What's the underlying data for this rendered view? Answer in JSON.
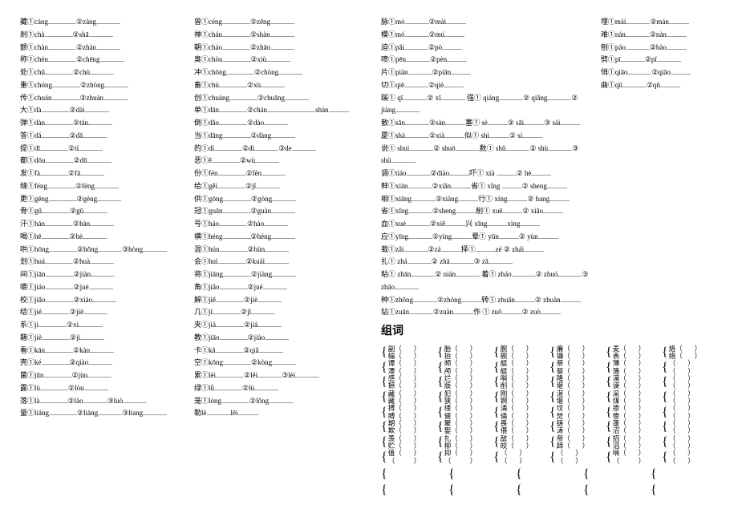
{
  "leftA": [
    {
      "c": "藏",
      "m1": "cáng",
      "m2": "zàng"
    },
    {
      "c": "刹",
      "m1": "chà",
      "m2": "shā"
    },
    {
      "c": "颤",
      "m1": "chàn",
      "m2": "zhàn"
    },
    {
      "c": "称",
      "m1": "chèn",
      "m2": "chēng"
    },
    {
      "c": "处",
      "m1": "chǔ",
      "m2": "chù"
    },
    {
      "c": "重",
      "m1": "chóng",
      "m2": "zhòng"
    },
    {
      "c": "传",
      "m1": "chuán",
      "m2": "zhuàn"
    },
    {
      "c": "大",
      "m1": "dà",
      "m2": "dài"
    },
    {
      "c": "弹",
      "m1": "dàn",
      "m2": "tán"
    },
    {
      "c": "答",
      "m1": "dá",
      "m2": "dā"
    },
    {
      "c": "提",
      "m1": "dī",
      "m2": "tí"
    },
    {
      "c": "都",
      "m1": "dōu",
      "m2": "dū"
    },
    {
      "c": "发",
      "m1": "fà",
      "m2": "fā"
    },
    {
      "c": "缝",
      "m1": "féng",
      "m2": "fèng"
    },
    {
      "c": "更",
      "m1": "gēng",
      "m2": "gèng"
    },
    {
      "c": "骨",
      "m1": "gǔ",
      "m2": "gū"
    },
    {
      "c": "汗",
      "m1": "hán",
      "m2": "hàn"
    },
    {
      "c": "喝",
      "m1": "hē",
      "m2": "hè"
    },
    {
      "c": "哄",
      "m1": "hōng",
      "m2": "hǒng",
      "m3": "hòng"
    },
    {
      "c": "划",
      "m1": "huá",
      "m2": "huà"
    },
    {
      "c": "间",
      "m1": "jiān",
      "m2": "jiàn"
    },
    {
      "c": "嚼",
      "m1": "jiáo",
      "m2": "jué"
    },
    {
      "c": "校",
      "m1": "jiǎo",
      "m2": "xiào"
    },
    {
      "c": "结",
      "m1": "jié",
      "m2": "jiē"
    },
    {
      "c": "系",
      "m1": "jì",
      "m2": "xì"
    },
    {
      "c": "藉",
      "m1": "jiè",
      "m2": "jí"
    },
    {
      "c": "看",
      "m1": "kān",
      "m2": "kàn"
    },
    {
      "c": "壳",
      "m1": "ké",
      "m2": "qiào"
    },
    {
      "c": "菌",
      "m1": "jūn",
      "m2": "jùn"
    },
    {
      "c": "露",
      "m1": "lù",
      "m2": "lòu"
    },
    {
      "c": "落",
      "m1": "là",
      "m2": "lào",
      "m3": "luò"
    },
    {
      "c": "量",
      "m1": "liáng",
      "m2": "liàng",
      "m3": "liang"
    }
  ],
  "leftB": [
    {
      "c": "曾",
      "m1": "céng",
      "m2": "zēng"
    },
    {
      "c": "  禅",
      "m1": "chán",
      "m2": "shàn"
    },
    {
      "c": "朝",
      "m1": "cháo",
      "m2": "zhāo"
    },
    {
      "c": "臭",
      "m1": "chòu",
      "m2": "xiù"
    },
    {
      "c": "  冲",
      "m1": "chōng",
      "m2": "chòng"
    },
    {
      "c": "畜",
      "m1": "chù",
      "m2": "xù"
    },
    {
      "c": "创",
      "m1": "chuàng",
      "m2": "chuāng"
    },
    {
      "c": "单",
      "m1": "dān",
      "m2": "chán",
      "t": "shàn"
    },
    {
      "c": "倒",
      "m1": "dǎo",
      "m2": "dào"
    },
    {
      "c": "当",
      "m1": "dāng",
      "m2": "dàng"
    },
    {
      "c": "的",
      "m1": "dí",
      "m2": "dì",
      "m3": "de"
    },
    {
      "c": "恶",
      "m1": "ě",
      "m2": "wù"
    },
    {
      "c": "份",
      "m1": "fèn",
      "m2": "fèn"
    },
    {
      "c": "给",
      "m1": "gěi",
      "m2": "jǐ"
    },
    {
      "c": "供",
      "m1": "gōng",
      "m2": "gòng"
    },
    {
      "c": "冠",
      "m1": "guān",
      "m2": "guàn"
    },
    {
      "c": "号",
      "m1": "háo",
      "m2": "hào"
    },
    {
      "c": "横",
      "m1": "héng",
      "m2": "hèng"
    },
    {
      "c": "混",
      "m1": "hún",
      "m2": "hùn"
    },
    {
      "c": "会",
      "m1": "huì",
      "m2": "kuài"
    },
    {
      "c": "将",
      "m1": "jiāng",
      "m2": "jiàng"
    },
    {
      "c": "角",
      "m1": "jiǎo",
      "m2": "jué"
    },
    {
      "c": "解",
      "m1": "jiě",
      "m2": "jiè"
    },
    {
      "c": "几",
      "m1": "jī",
      "m2": "jǐ"
    },
    {
      "c": "  夹",
      "m1": "jiá",
      "m2": "jiá"
    },
    {
      "c": "教",
      "m1": "jiāo",
      "m2": "jiào"
    },
    {
      "c": "卡",
      "m1": "kǎ",
      "m2": "qiǎ"
    },
    {
      "c": "空",
      "m1": "kōng",
      "m2": "kòng"
    },
    {
      "c": "累",
      "m1": "lèi",
      "m2": "lěi",
      "m3": "lèi"
    },
    {
      "c": "绿",
      "m1": "lǜ",
      "m2": "lù"
    },
    {
      "c": "笼",
      "m1": "lóng",
      "m2": "lǒng"
    },
    {
      "c": "勒lè",
      "t": "lēi",
      "tonly": true
    }
  ],
  "rightA": [
    {
      "c": "脉",
      "m1": "mò",
      "m2": "mài"
    },
    {
      "c": "模",
      "m1": "mó",
      "m2": "mú"
    },
    {
      "c": "迫",
      "m1": "pǎi",
      "m2": "pò"
    },
    {
      "c": "喷",
      "m1": "pēn",
      "m2": "pèn"
    },
    {
      "c": "片",
      "m1": "piàn",
      "m2": "piān"
    },
    {
      "c": "切",
      "m1": "qiē",
      "m2": "qiè"
    },
    {
      "raw": "蹊① qī______② xī______ 强① qiáng____② qiǎng____② jiàng____"
    },
    {
      "c": "散",
      "m1": "sǎn",
      "m2": "sàn",
      "suffix": "塞① sè______② sāi_____③ sài_____"
    },
    {
      "c": "厦",
      "m1": "shà",
      "m2": "xià",
      "suffix": "似① shì______② sì______"
    },
    {
      "raw": "说① shuì_____② shuō_____数① shǔ______② shù______③ shù______"
    },
    {
      "c": "调",
      "m1": "tiáo",
      "m2": "diào",
      "suffix": "吓① xià _______② hè______"
    },
    {
      "c": "鲜",
      "m1": "xiān",
      "m2": "xiǎn",
      "suffix": "省① xǐng ______② sheng____"
    },
    {
      "c": "相",
      "m1": "xiāng",
      "m2": "xiàng",
      "suffix": "行① xíng_______② hang____"
    },
    {
      "c": "省",
      "m1": "xǐng",
      "m2": "sheng",
      "suffix": "削① xuē_______② xiāo______"
    },
    {
      "c": "血",
      "m1": "xuè",
      "m2": "xiě",
      "suffix": "兴 xīng______xìng______"
    },
    {
      "c": "应",
      "m1": "yīng",
      "m2": "yìng",
      "suffix": "晕① yūn________② yùn______"
    },
    {
      "c": "载",
      "m1": "zǎi",
      "m2": "zà",
      "suffix": "择①_________zé ② zhái______"
    },
    {
      "raw": "扎① zhá______② zhā_____③ zā______"
    },
    {
      "raw": "粘① zhān_____② nián______ 着① zháo____② zhuó____③ zhāo____"
    },
    {
      "c": "种",
      "m1": "zhōng",
      "m2": "zhòng",
      "suffix": "转① zhuǎn_____② zhuàn______"
    },
    {
      "c": "钻",
      "m1": "zuān",
      "m2": "zuàn",
      "suffix": "作 ① zuō______② zuò_______"
    }
  ],
  "rightTopB": [
    {
      "c": "埋",
      "m1": "mái",
      "m2": "mán"
    },
    {
      "c": "难",
      "m1": "nán",
      "m2": "nàn"
    },
    {
      "c": "刨",
      "m1": "páo",
      "m2": "bào"
    },
    {
      "raw": "劈①pī____②pǐ_________"
    },
    {
      "c": "悄",
      "m1": "qiāo",
      "m2": "qiāo"
    },
    {
      "c": "曲",
      "m1": "qū",
      "m2": "qǔ"
    }
  ],
  "section_heading": "组词",
  "zuci": [
    [
      [
        "副",
        "幅"
      ],
      [
        "胎",
        "抬"
      ],
      [
        "腕",
        "碗"
      ],
      [
        "廉",
        "镰"
      ],
      [
        "麦",
        "表"
      ],
      [
        "烙",
        "络"
      ]
    ],
    [
      [
        "谭",
        "潭"
      ],
      [
        "频",
        "颅"
      ],
      [
        "艇",
        "艇"
      ],
      [
        "祭",
        "蔡"
      ],
      [
        "薄",
        "簿"
      ],
      [
        " ",
        " "
      ]
    ],
    [
      [
        "感",
        "撼"
      ],
      [
        "烂",
        "版"
      ],
      [
        "哨",
        "削"
      ],
      [
        "隆",
        "堪"
      ],
      [
        "漠",
        "谟"
      ],
      [
        " ",
        " "
      ]
    ],
    [
      [
        "藏",
        "藏"
      ],
      [
        "犯",
        "狭"
      ],
      [
        "刚",
        "锕"
      ],
      [
        "湛",
        "堪"
      ],
      [
        "采",
        "煤"
      ],
      [
        " ",
        " "
      ]
    ],
    [
      [
        "搏",
        "膊"
      ],
      [
        "缕",
        "健"
      ],
      [
        "涌",
        "俑"
      ],
      [
        "坟",
        "焚"
      ],
      [
        "掺",
        "惨"
      ],
      [
        " ",
        " "
      ]
    ],
    [
      [
        "期",
        "欺"
      ],
      [
        "聚",
        "娶"
      ],
      [
        "畏",
        "偎"
      ],
      [
        "铸",
        "涛"
      ],
      [
        "蓬",
        "沼"
      ],
      [
        " ",
        " "
      ]
    ],
    [
      [
        "羡",
        "贮"
      ],
      [
        "扎",
        "柳"
      ],
      [
        "敌",
        "皎"
      ],
      [
        "帝",
        "蹄"
      ],
      [
        "招",
        "滔"
      ],
      [
        " ",
        " "
      ]
    ],
    [
      [
        "值",
        "  "
      ],
      [
        "抑",
        " "
      ],
      [
        " ",
        "  "
      ],
      [
        " ",
        "  "
      ],
      [
        "啃",
        " "
      ],
      [
        " ",
        " "
      ]
    ]
  ]
}
